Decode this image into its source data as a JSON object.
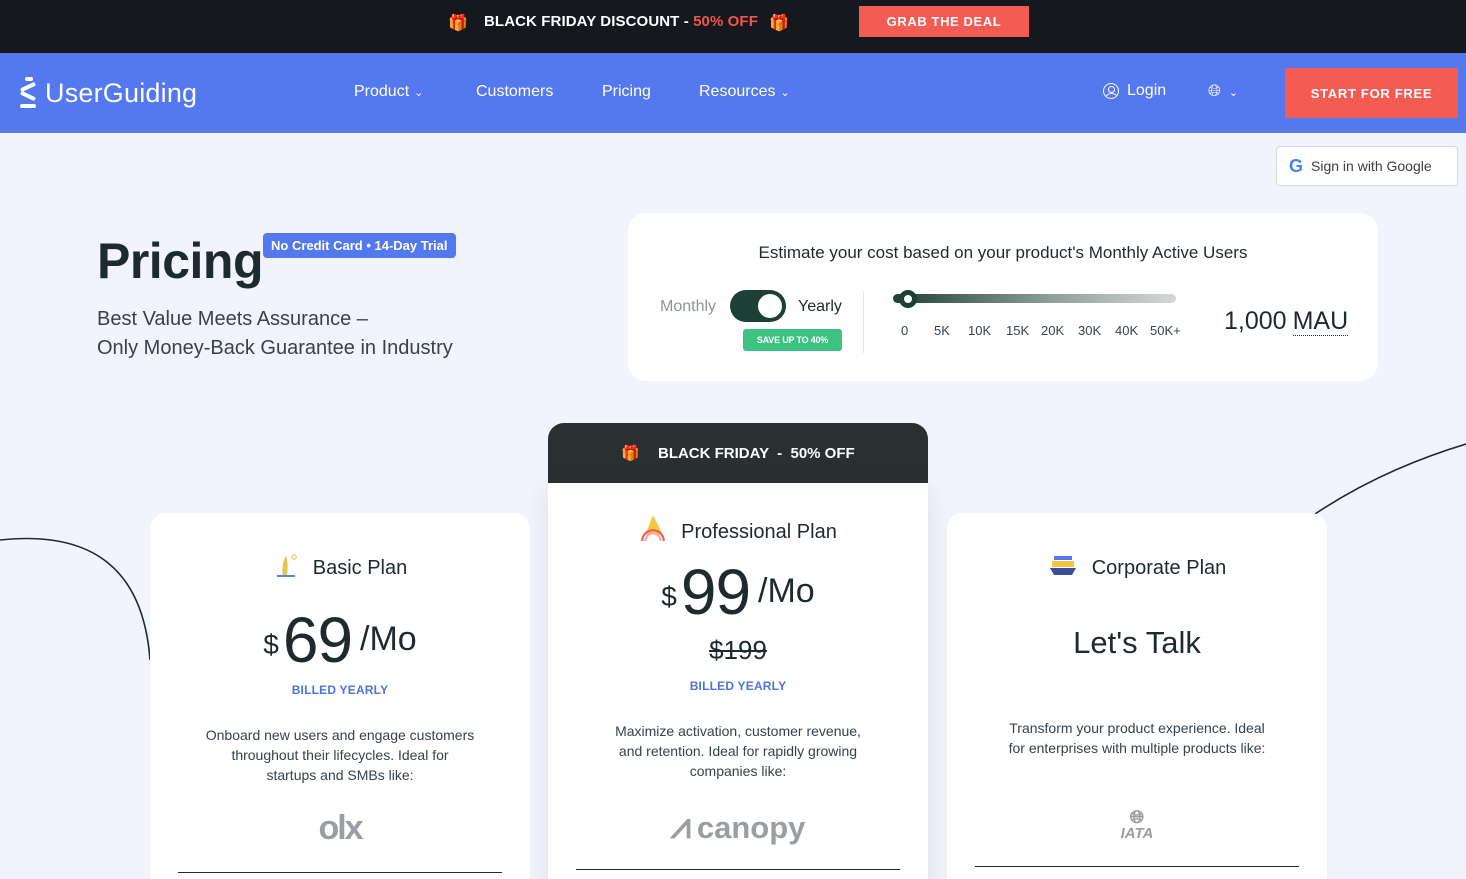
{
  "promo": {
    "text": "BLACK FRIDAY DISCOUNT - ",
    "off": "50% OFF",
    "cta": "GRAB THE DEAL",
    "gift_icon": "gift-icon"
  },
  "nav": {
    "brand": "UserGuiding",
    "items": [
      {
        "label": "Product",
        "has_chevron": true
      },
      {
        "label": "Customers",
        "has_chevron": false
      },
      {
        "label": "Pricing",
        "has_chevron": false
      },
      {
        "label": "Resources",
        "has_chevron": true
      }
    ],
    "login": "Login",
    "cta": "START FOR FREE"
  },
  "google_signin": "Sign in with Google",
  "hero": {
    "title": "Pricing",
    "badge": "No Credit Card • 14-Day Trial",
    "subtitle_line1": "Best Value Meets Assurance –",
    "subtitle_line2": "Only Money-Back Guarantee in Industry"
  },
  "estimator": {
    "title": "Estimate your cost based on your product's Monthly Active Users",
    "monthly_label": "Monthly",
    "yearly_label": "Yearly",
    "billing": "yearly",
    "save_badge": "SAVE UP TO 40%",
    "ticks": [
      "0",
      "5K",
      "10K",
      "15K",
      "20K",
      "30K",
      "40K",
      "50K+"
    ],
    "slider_value": 1000,
    "mau_value": "1,000",
    "mau_unit": "MAU"
  },
  "plans": {
    "basic": {
      "name": "Basic Plan",
      "currency": "$",
      "price": "69",
      "per": "/Mo",
      "billed": "BILLED YEARLY",
      "desc": "Onboard new users and engage customers throughout their lifecycles. Ideal for startups and SMBs like:",
      "client": "olx"
    },
    "pro": {
      "banner": "BLACK FRIDAY  -  50% OFF",
      "name": "Professional Plan",
      "currency": "$",
      "price": "99",
      "per": "/Mo",
      "old_price": "$199",
      "billed": "BILLED YEARLY",
      "desc": "Maximize activation, customer revenue, and retention. Ideal for rapidly growing companies like:",
      "client": "canopy"
    },
    "corporate": {
      "name": "Corporate Plan",
      "cta_text": "Let's Talk",
      "desc": "Transform your product experience. Ideal for enterprises with multiple products like:",
      "client": "IATA"
    }
  },
  "colors": {
    "nav_bg": "#5478ee",
    "cta_red": "#f35b53",
    "promo_bg": "#15181d",
    "toggle_green": "#1d4036",
    "save_green": "#3cc382",
    "billed_blue": "#4f74d8"
  }
}
